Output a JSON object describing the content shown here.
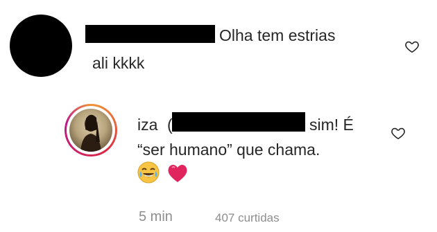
{
  "comment": {
    "text_line1": "Olha tem estrias",
    "text_line2": "ali kkkk",
    "like_icon": "heart-outline-icon"
  },
  "reply": {
    "username": "iza",
    "text_after_mention": "sim! É",
    "text_line2": "“ser humano” que chama.",
    "emojis": [
      "joy-emoji",
      "red-heart-emoji"
    ],
    "time": "5 min",
    "likes": "407 curtidas",
    "like_icon": "heart-outline-icon"
  },
  "colors": {
    "text": "#262626",
    "meta": "#8e8e8e",
    "heart": "#e0245e"
  }
}
